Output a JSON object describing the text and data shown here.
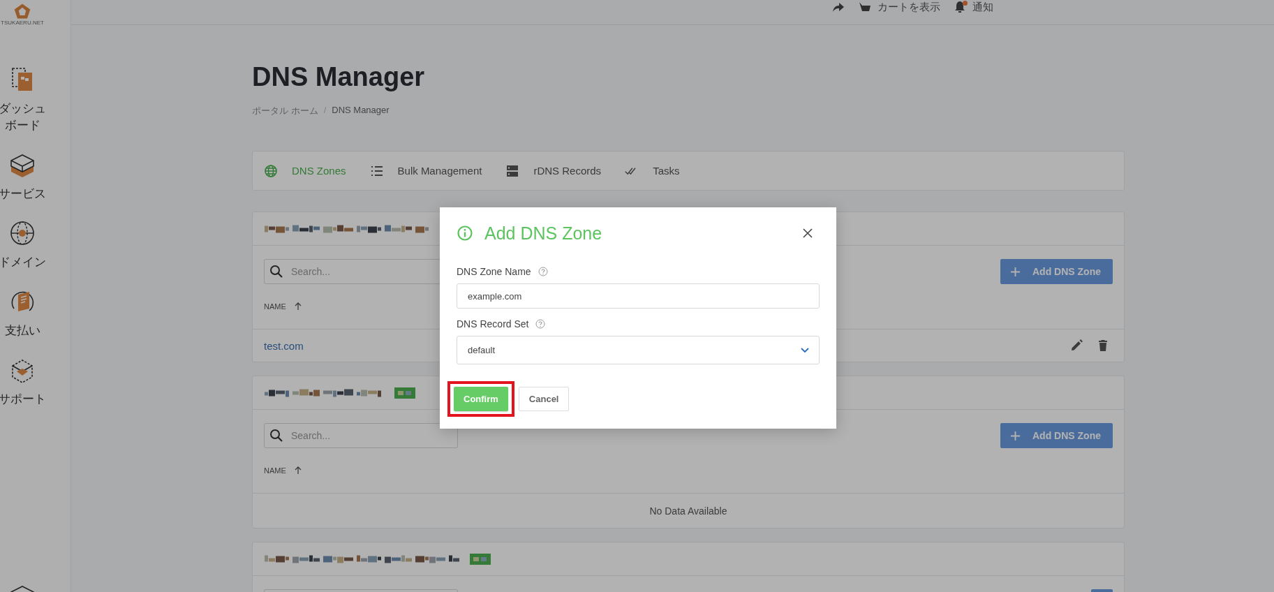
{
  "logo": {
    "text": "TSUKAERU.NET"
  },
  "sidebar": {
    "items": [
      {
        "kind": "dashboard",
        "label": "ダッシュボード"
      },
      {
        "kind": "services",
        "label": "サービス"
      },
      {
        "kind": "domain",
        "label": "ドメイン"
      },
      {
        "kind": "billing",
        "label": "支払い"
      },
      {
        "kind": "support",
        "label": "サポート"
      },
      {
        "kind": "services"
      }
    ]
  },
  "header": {
    "items": [
      {
        "kind": "share"
      },
      {
        "kind": "cart",
        "label": "カートを表示"
      },
      {
        "kind": "bell",
        "label": "通知",
        "badge": true
      }
    ]
  },
  "page": {
    "title": "DNS Manager",
    "breadcrumb": [
      "ポータル ホーム",
      "DNS Manager"
    ],
    "separator": "/"
  },
  "tabs": [
    {
      "kind": "globe",
      "label": "DNS Zones",
      "selected": true
    },
    {
      "kind": "list",
      "label": "Bulk Management",
      "selected": false
    },
    {
      "kind": "server",
      "label": "rDNS Records",
      "selected": false
    },
    {
      "kind": "checks",
      "label": "Tasks",
      "selected": false
    }
  ],
  "cards": [
    {
      "kind": "zones",
      "search_placeholder": "Search...",
      "button": "Add DNS Zone",
      "column": "NAME",
      "rows": [
        {
          "name": "test.com"
        }
      ]
    },
    {
      "kind": "zones",
      "search_placeholder": "Search...",
      "button": "Add DNS Zone",
      "column": "NAME",
      "empty": "No Data Available"
    },
    {
      "kind": "zones"
    }
  ],
  "modal": {
    "title": "Add DNS Zone",
    "fields": [
      {
        "kind": "text",
        "label": "DNS Zone Name",
        "value": "example.com"
      },
      {
        "kind": "select",
        "label": "DNS Record Set",
        "value": "default"
      }
    ],
    "buttons": [
      {
        "kind": "primary",
        "label": "Confirm",
        "highlighted": true
      },
      {
        "kind": "secondary",
        "label": "Cancel",
        "highlighted": false
      }
    ]
  }
}
